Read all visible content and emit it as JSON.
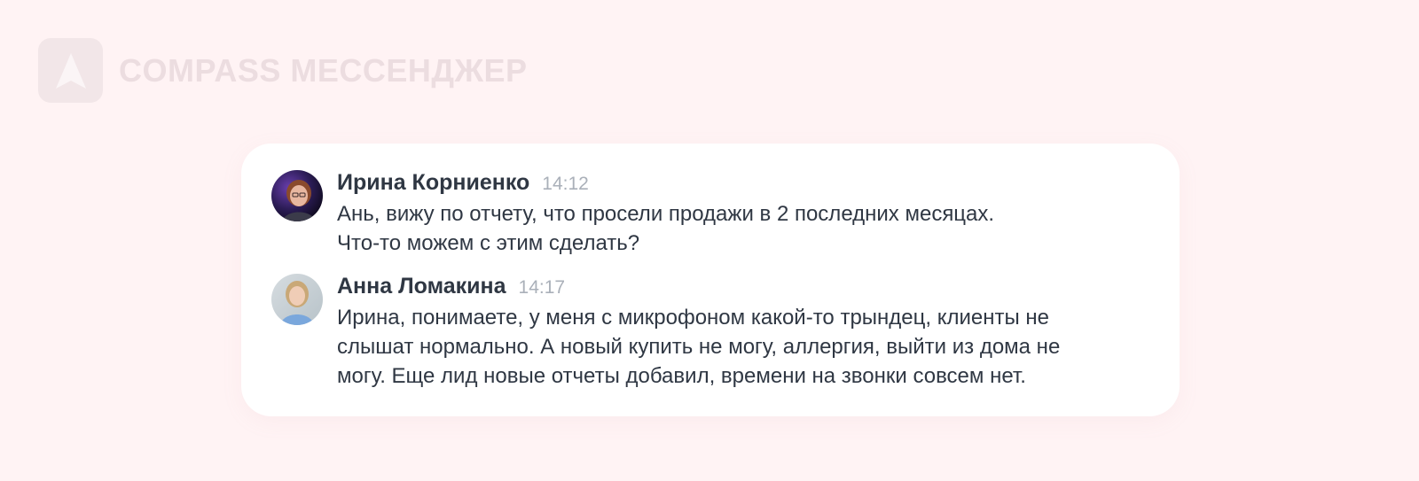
{
  "app": {
    "brand_name": "COMPASS МЕССЕНДЖЕР",
    "logo_icon": "compass-logo-icon"
  },
  "colors": {
    "background": "#fff3f4",
    "card": "#ffffff",
    "author": "#2f3743",
    "time": "#aab0b9",
    "brand_faded": "#ecdde0"
  },
  "messages": [
    {
      "author": "Ирина Корниенко",
      "time": "14:12",
      "avatar_icon": "user-avatar-icon",
      "lines": [
        "Ань, вижу по отчету, что просели продажи в 2 последних месяцах.",
        "Что-то можем с этим сделать?"
      ]
    },
    {
      "author": "Анна Ломакина",
      "time": "14:17",
      "avatar_icon": "user-avatar-icon",
      "lines": [
        "Ирина, понимаете, у меня с микрофоном какой-то трындец, клиенты не",
        "слышат нормально. А новый купить не могу, аллергия, выйти из дома не",
        "могу. Еще лид новые отчеты добавил, времени на звонки совсем нет."
      ]
    }
  ]
}
